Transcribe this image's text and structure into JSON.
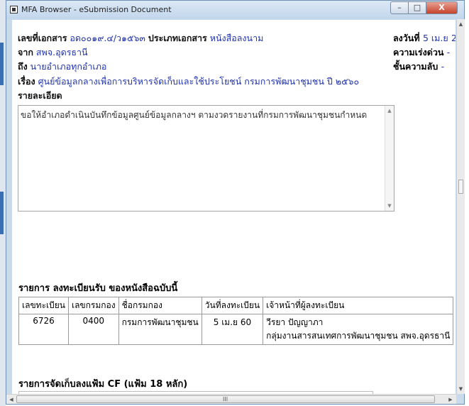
{
  "window": {
    "title": "MFA Browser - eSubmission Document",
    "minimize": "–",
    "maximize": "□",
    "close": "X"
  },
  "doc": {
    "doc_no_label": "เลขที่เอกสาร",
    "doc_no": "อด๐๐๑๙.๔/ว๑๕๖๓",
    "doc_type_label": "ประเภทเอกสาร",
    "doc_type": "หนังสือลงนาม",
    "from_label": "จาก",
    "from": "สพจ.อุดรธานี",
    "to_label": "ถึง",
    "to": "นายอำเภอทุกอำเภอ",
    "subject_label": "เรื่อง",
    "subject": "ศูนย์ข้อมูลกลางเพื่อการบริหารจัดเก็บและใช้ประโยชน์  กรมการพัฒนาชุมชน  ปี  ๒๕๖๐",
    "date_label": "ลงวันที่",
    "date": "5 เม.ย",
    "date_tail": "2",
    "urgency_label": "ความเร่งด่วน",
    "urgency": "-",
    "secrecy_label": "ชั้นความลับ",
    "secrecy": "-",
    "detail_label": "รายละเอียด",
    "detail": "ขอให้อำเภอดำเนินบันทึกข้อมูลศูนย์ข้อมูลกลางฯ  ตามงวดรายงานที่กรมการพัฒนาชุมชนกำหนด"
  },
  "registration": {
    "title": "รายการ  ลงทะเบียนรับ  ของหนังสือฉบับนี้",
    "headers": [
      "เลขทะเบียน",
      "เลขกรมกอง",
      "ชื่อกรมกอง",
      "วันที่ลงทะเบียน",
      "เจ้าหน้าที่ผู้ลงทะเบียน"
    ],
    "rows": [
      {
        "reg_no": "6726",
        "dept_no": "0400",
        "dept_name": "กรมการพัฒนาชุมชน",
        "reg_date": "5 เม.ย  60",
        "officer": "วีรยา  ปัญญาภา",
        "officer_unit": "กลุ่มงานสารสนเทศการพัฒนาชุมชน  สพจ.อุดรธานี"
      }
    ]
  },
  "filing": {
    "title": "รายการจัดเก็บลงแฟ้ม  CF (แฟ้ม  18 หลัก)"
  },
  "scrollbar": {
    "grip": "III"
  }
}
